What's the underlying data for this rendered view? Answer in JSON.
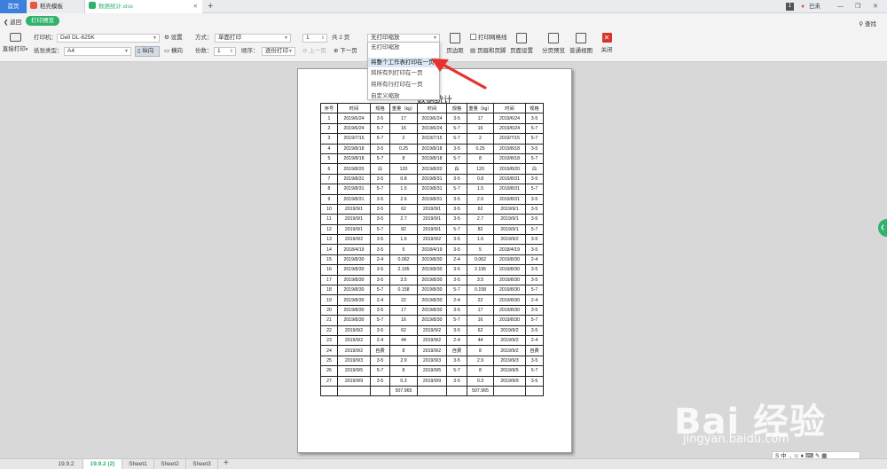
{
  "titlebar": {
    "tabs": [
      {
        "label": "首页"
      },
      {
        "label": "稻壳模板"
      },
      {
        "label": "数据统计.xlsx"
      }
    ],
    "new_tab": "+",
    "badge": "1",
    "user": "已未"
  },
  "toolbar": {
    "back_label": "返回",
    "preview_label": "打印预览",
    "find_label": "查找",
    "printer_label": "打印机：",
    "printer_value": "Dell DL-625K",
    "settings_label": "设置",
    "direct_print_label": "直接打印",
    "paper_label": "纸张类型：",
    "paper_value": "A4",
    "portrait_label": "纵向",
    "landscape_label": "横向",
    "method_label": "方式：",
    "method_value": "单面打印",
    "copies_label": "份数：",
    "copies_value": "1",
    "order_label": "顺序：",
    "order_value": "逐份打印",
    "page_value": "1",
    "total_pages": "共 2 页",
    "prev_page": "上一页",
    "next_page": "下一页",
    "scale_value": "无打印缩放",
    "margins_label": "页边距",
    "gridlines_label": "打印网格线",
    "header_footer_label": "页眉和页脚",
    "page_setup_label": "页面设置",
    "page_break_label": "分页预览",
    "normal_view_label": "普通视图",
    "close_label": "关闭"
  },
  "dropdown": {
    "items": [
      "无打印缩放",
      "将整个工作表打印在一页",
      "将所有列打印在一页",
      "将所有行打印在一页",
      "自定义缩放"
    ],
    "highlighted": "将整个工作表打印在一页"
  },
  "document": {
    "title": "数据统计",
    "headers": [
      "序号",
      "时间",
      "规格",
      "重量（kg）",
      "时间",
      "规格",
      "重量（kg）",
      "时间",
      "规格"
    ],
    "rows": [
      [
        "1",
        "2019/6/24",
        "3-5",
        "17",
        "2019/6/24",
        "3-5",
        "17",
        "2019/6/24",
        "3-5"
      ],
      [
        "2",
        "2019/6/24",
        "5-7",
        "16",
        "2019/6/24",
        "5-7",
        "16",
        "2019/6/24",
        "5-7"
      ],
      [
        "3",
        "2019/7/15",
        "5-7",
        "2",
        "2019/7/15",
        "5-7",
        "2",
        "2019/7/15",
        "5-7"
      ],
      [
        "4",
        "2019/8/18",
        "3-5",
        "0.25",
        "2019/8/18",
        "3-5",
        "0.25",
        "2019/8/18",
        "3-5"
      ],
      [
        "5",
        "2019/8/18",
        "5-7",
        "8",
        "2019/8/18",
        "5-7",
        "8",
        "2019/8/18",
        "5-7"
      ],
      [
        "6",
        "2019/8/20",
        "白",
        "120",
        "2019/8/20",
        "白",
        "120",
        "2019/8/20",
        "白"
      ],
      [
        "7",
        "2019/8/31",
        "3-5",
        "0.8",
        "2019/8/31",
        "3-5",
        "0.8",
        "2019/8/31",
        "3-5"
      ],
      [
        "8",
        "2019/8/31",
        "5-7",
        "1.5",
        "2019/8/31",
        "5-7",
        "1.5",
        "2019/8/31",
        "5-7"
      ],
      [
        "9",
        "2019/8/31",
        "3-5",
        "2.6",
        "2019/8/31",
        "3-5",
        "2.6",
        "2019/8/31",
        "3-5"
      ],
      [
        "10",
        "2019/9/1",
        "3-5",
        "62",
        "2019/9/1",
        "3-5",
        "62",
        "2019/9/1",
        "3-5"
      ],
      [
        "11",
        "2019/9/1",
        "3-5",
        "2.7",
        "2019/9/1",
        "3-5",
        "2.7",
        "2019/9/1",
        "3-5"
      ],
      [
        "12",
        "2019/9/1",
        "5-7",
        "82",
        "2019/9/1",
        "5-7",
        "82",
        "2019/9/1",
        "5-7"
      ],
      [
        "13",
        "2019/9/2",
        "3-5",
        "1.6",
        "2019/9/2",
        "3-5",
        "1.6",
        "2019/9/2",
        "3-5"
      ],
      [
        "14",
        "2018/4/19",
        "3-5",
        "5",
        "2018/4/19",
        "3-5",
        "5",
        "2018/4/19",
        "3-5"
      ],
      [
        "15",
        "2019/8/30",
        "2-4",
        "0.062",
        "2019/8/30",
        "2-4",
        "0.062",
        "2019/8/30",
        "2-4"
      ],
      [
        "16",
        "2019/8/30",
        "3-5",
        "2.195",
        "2019/8/30",
        "3-5",
        "2.195",
        "2019/8/30",
        "3-5"
      ],
      [
        "17",
        "2019/8/30",
        "3-5",
        "3.5",
        "2019/8/30",
        "3-5",
        "3.5",
        "2019/8/30",
        "3-5"
      ],
      [
        "18",
        "2019/8/30",
        "5-7",
        "0.158",
        "2019/8/30",
        "5-7",
        "0.158",
        "2019/8/30",
        "5-7"
      ],
      [
        "19",
        "2019/8/30",
        "2-4",
        "22",
        "2019/8/30",
        "2-4",
        "22",
        "2019/8/30",
        "2-4"
      ],
      [
        "20",
        "2019/8/30",
        "3-5",
        "17",
        "2019/8/30",
        "3-5",
        "17",
        "2019/8/30",
        "3-5"
      ],
      [
        "21",
        "2019/8/30",
        "5-7",
        "16",
        "2019/8/30",
        "5-7",
        "16",
        "2019/8/30",
        "5-7"
      ],
      [
        "22",
        "2019/9/2",
        "3-5",
        "62",
        "2019/9/2",
        "3-5",
        "62",
        "2019/9/2",
        "3-5"
      ],
      [
        "23",
        "2019/9/2",
        "2-4",
        "44",
        "2019/9/2",
        "2-4",
        "44",
        "2019/9/2",
        "2-4"
      ],
      [
        "24",
        "2019/9/2",
        "自费",
        "8",
        "2019/9/2",
        "自费",
        "8",
        "2019/9/2",
        "自费"
      ],
      [
        "25",
        "2019/9/3",
        "3-5",
        "2.9",
        "2019/9/3",
        "3-5",
        "2.9",
        "2019/9/3",
        "3-5"
      ],
      [
        "26",
        "2019/9/5",
        "5-7",
        "8",
        "2019/9/5",
        "5-7",
        "8",
        "2019/9/5",
        "5-7"
      ],
      [
        "27",
        "2019/9/9",
        "3-5",
        "0.3",
        "2019/9/9",
        "3-5",
        "0.3",
        "2019/9/9",
        "3-5"
      ],
      [
        "",
        "",
        "",
        "507.965",
        "",
        "",
        "507.965",
        "",
        ""
      ]
    ]
  },
  "sheets": {
    "tabs": [
      "19.9.2",
      "19.9.2 (2)",
      "Sheet1",
      "Sheet2",
      "Sheet3"
    ],
    "active": "19.9.2 (2)",
    "add": "+"
  },
  "ime": {
    "text": "S 中 ·, ☺ ♦ ⌨ ✎ ▦"
  },
  "watermark": {
    "brand": "Bai 经验",
    "url": "jingyan.baidu.com"
  },
  "colors": {
    "accent": "#2fb26b",
    "home_tab": "#3d7fdc",
    "arrow": "#e8312f",
    "close": "#d9342b"
  }
}
